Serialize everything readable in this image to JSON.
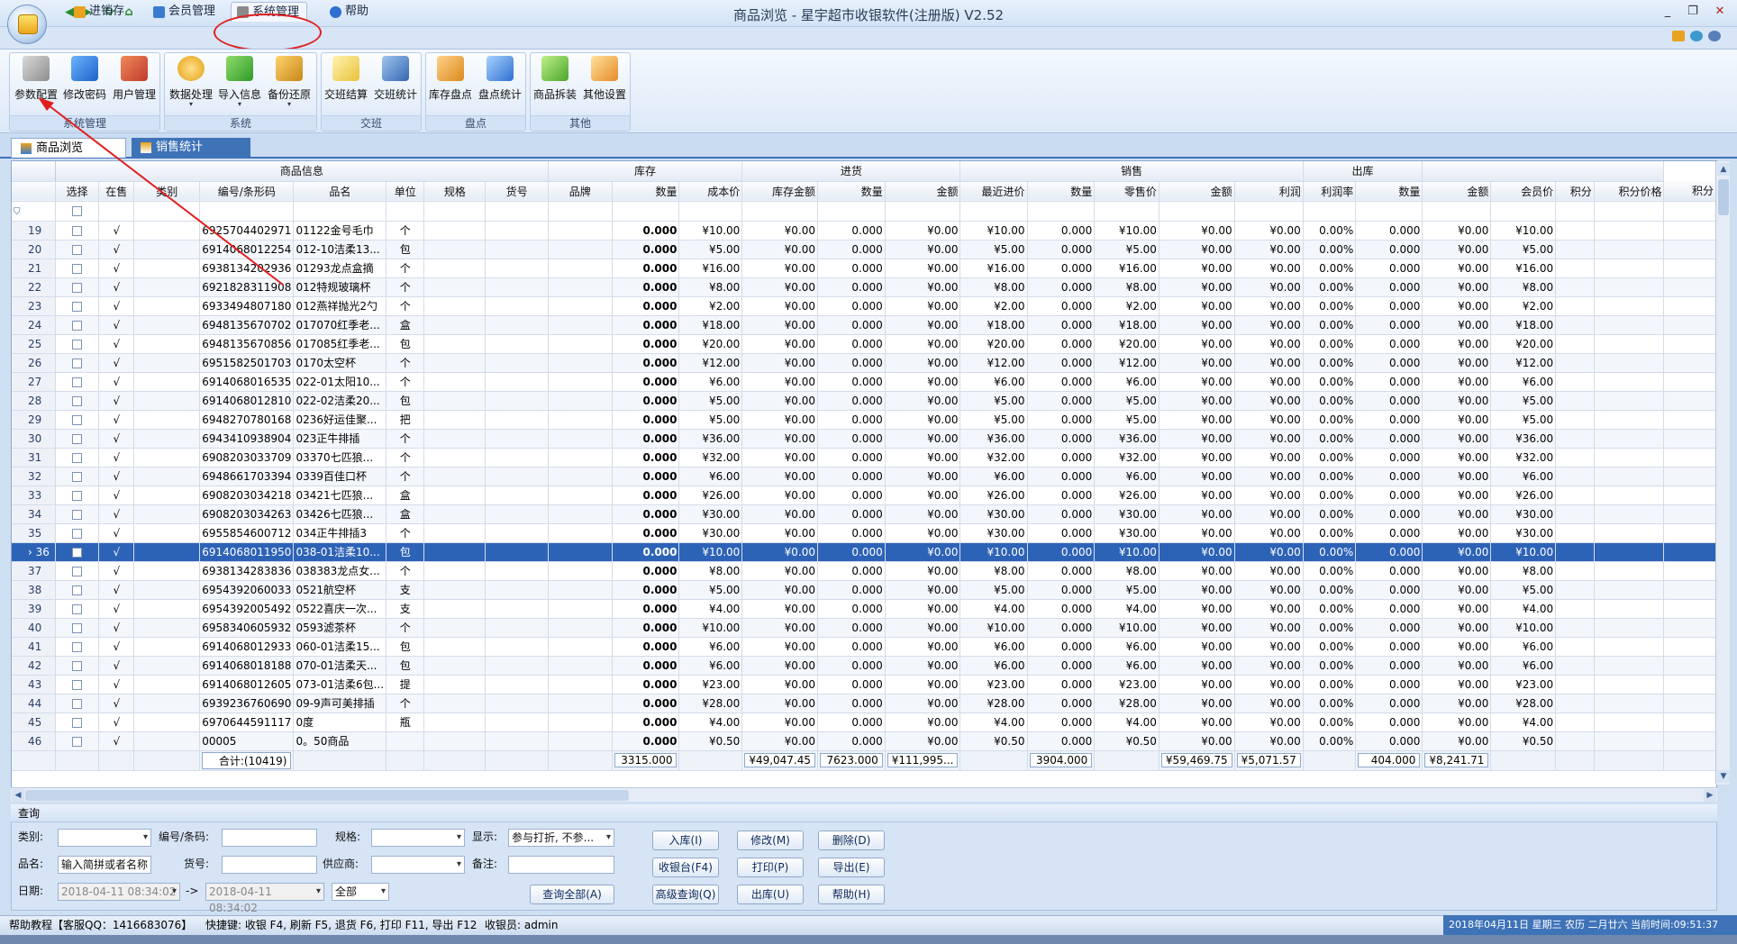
{
  "window": {
    "title": "商品浏览 - 星宇超市收银软件(注册版) V2.52"
  },
  "ribbon_tabs": [
    {
      "label": "进销存",
      "color": "#e8a21e"
    },
    {
      "label": "会员管理",
      "color": "#3a7bd0"
    },
    {
      "label": "系统管理",
      "color": "#8a8a8a"
    },
    {
      "label": "帮助",
      "color": "#2f6fd0"
    }
  ],
  "ribbon_groups": [
    {
      "label": "系统管理",
      "buttons": [
        {
          "label": "参数配置",
          "icon": "wrench-icon"
        },
        {
          "label": "修改密码",
          "icon": "key-icon"
        },
        {
          "label": "用户管理",
          "icon": "users-icon"
        }
      ]
    },
    {
      "label": "系统",
      "buttons": [
        {
          "label": "数据处理",
          "icon": "gear-icon"
        },
        {
          "label": "导入信息",
          "icon": "import-icon"
        },
        {
          "label": "备份还原",
          "icon": "backup-icon"
        }
      ]
    },
    {
      "label": "交班",
      "buttons": [
        {
          "label": "交班结算",
          "icon": "clipboard-icon"
        },
        {
          "label": "交班统计",
          "icon": "calendar-icon"
        }
      ]
    },
    {
      "label": "盘点",
      "buttons": [
        {
          "label": "库存盘点",
          "icon": "calculator-icon"
        },
        {
          "label": "盘点统计",
          "icon": "chart-icon"
        }
      ]
    },
    {
      "label": "其他",
      "buttons": [
        {
          "label": "商品拆装",
          "icon": "box-icon"
        },
        {
          "label": "其他设置",
          "icon": "settings-window-icon"
        }
      ]
    }
  ],
  "doc_tabs": [
    "商品浏览",
    "销售统计"
  ],
  "grid": {
    "header_groups": [
      "商品信息",
      "库存",
      "进货",
      "销售",
      "出库"
    ],
    "columns": [
      "选择",
      "在售",
      "类别",
      "编号/条形码",
      "品名",
      "单位",
      "规格",
      "货号",
      "品牌",
      "数量",
      "成本价",
      "库存金额",
      "数量",
      "金额",
      "最近进价",
      "数量",
      "零售价",
      "金额",
      "利润",
      "利润率",
      "数量",
      "金额",
      "会员价",
      "积分",
      "积分价格",
      "积分"
    ],
    "rows": [
      [
        "19",
        "√",
        "6925704402971",
        "01122金号毛巾",
        "个",
        "0.000",
        "¥10.00",
        "¥0.00",
        "0.000",
        "¥0.00",
        "¥10.00",
        "0.000",
        "¥10.00",
        "¥0.00",
        "¥0.00",
        "0.00%",
        "0.000",
        "¥0.00",
        "¥10.00"
      ],
      [
        "20",
        "√",
        "6914068012254",
        "012-10洁柔13...",
        "包",
        "0.000",
        "¥5.00",
        "¥0.00",
        "0.000",
        "¥0.00",
        "¥5.00",
        "0.000",
        "¥5.00",
        "¥0.00",
        "¥0.00",
        "0.00%",
        "0.000",
        "¥0.00",
        "¥5.00"
      ],
      [
        "21",
        "√",
        "6938134202936",
        "01293龙点盒摘",
        "个",
        "0.000",
        "¥16.00",
        "¥0.00",
        "0.000",
        "¥0.00",
        "¥16.00",
        "0.000",
        "¥16.00",
        "¥0.00",
        "¥0.00",
        "0.00%",
        "0.000",
        "¥0.00",
        "¥16.00"
      ],
      [
        "22",
        "√",
        "6921828311908",
        "012特规玻璃杯",
        "个",
        "0.000",
        "¥8.00",
        "¥0.00",
        "0.000",
        "¥0.00",
        "¥8.00",
        "0.000",
        "¥8.00",
        "¥0.00",
        "¥0.00",
        "0.00%",
        "0.000",
        "¥0.00",
        "¥8.00"
      ],
      [
        "23",
        "√",
        "6933494807180",
        "012燕祥抛光2勺",
        "个",
        "0.000",
        "¥2.00",
        "¥0.00",
        "0.000",
        "¥0.00",
        "¥2.00",
        "0.000",
        "¥2.00",
        "¥0.00",
        "¥0.00",
        "0.00%",
        "0.000",
        "¥0.00",
        "¥2.00"
      ],
      [
        "24",
        "√",
        "6948135670702",
        "017070红季老...",
        "盒",
        "0.000",
        "¥18.00",
        "¥0.00",
        "0.000",
        "¥0.00",
        "¥18.00",
        "0.000",
        "¥18.00",
        "¥0.00",
        "¥0.00",
        "0.00%",
        "0.000",
        "¥0.00",
        "¥18.00"
      ],
      [
        "25",
        "√",
        "6948135670856",
        "017085红季老...",
        "包",
        "0.000",
        "¥20.00",
        "¥0.00",
        "0.000",
        "¥0.00",
        "¥20.00",
        "0.000",
        "¥20.00",
        "¥0.00",
        "¥0.00",
        "0.00%",
        "0.000",
        "¥0.00",
        "¥20.00"
      ],
      [
        "26",
        "√",
        "6951582501703",
        "0170太空杯",
        "个",
        "0.000",
        "¥12.00",
        "¥0.00",
        "0.000",
        "¥0.00",
        "¥12.00",
        "0.000",
        "¥12.00",
        "¥0.00",
        "¥0.00",
        "0.00%",
        "0.000",
        "¥0.00",
        "¥12.00"
      ],
      [
        "27",
        "√",
        "6914068016535",
        "022-01太阳10...",
        "个",
        "0.000",
        "¥6.00",
        "¥0.00",
        "0.000",
        "¥0.00",
        "¥6.00",
        "0.000",
        "¥6.00",
        "¥0.00",
        "¥0.00",
        "0.00%",
        "0.000",
        "¥0.00",
        "¥6.00"
      ],
      [
        "28",
        "√",
        "6914068012810",
        "022-02洁柔20...",
        "包",
        "0.000",
        "¥5.00",
        "¥0.00",
        "0.000",
        "¥0.00",
        "¥5.00",
        "0.000",
        "¥5.00",
        "¥0.00",
        "¥0.00",
        "0.00%",
        "0.000",
        "¥0.00",
        "¥5.00"
      ],
      [
        "29",
        "√",
        "6948270780168",
        "0236好运佳聚...",
        "把",
        "0.000",
        "¥5.00",
        "¥0.00",
        "0.000",
        "¥0.00",
        "¥5.00",
        "0.000",
        "¥5.00",
        "¥0.00",
        "¥0.00",
        "0.00%",
        "0.000",
        "¥0.00",
        "¥5.00"
      ],
      [
        "30",
        "√",
        "6943410938904",
        "023正牛排插",
        "个",
        "0.000",
        "¥36.00",
        "¥0.00",
        "0.000",
        "¥0.00",
        "¥36.00",
        "0.000",
        "¥36.00",
        "¥0.00",
        "¥0.00",
        "0.00%",
        "0.000",
        "¥0.00",
        "¥36.00"
      ],
      [
        "31",
        "√",
        "6908203033709",
        "03370七匹狼...",
        "个",
        "0.000",
        "¥32.00",
        "¥0.00",
        "0.000",
        "¥0.00",
        "¥32.00",
        "0.000",
        "¥32.00",
        "¥0.00",
        "¥0.00",
        "0.00%",
        "0.000",
        "¥0.00",
        "¥32.00"
      ],
      [
        "32",
        "√",
        "6948661703394",
        "0339百佳口杯",
        "个",
        "0.000",
        "¥6.00",
        "¥0.00",
        "0.000",
        "¥0.00",
        "¥6.00",
        "0.000",
        "¥6.00",
        "¥0.00",
        "¥0.00",
        "0.00%",
        "0.000",
        "¥0.00",
        "¥6.00"
      ],
      [
        "33",
        "√",
        "6908203034218",
        "03421七匹狼...",
        "盒",
        "0.000",
        "¥26.00",
        "¥0.00",
        "0.000",
        "¥0.00",
        "¥26.00",
        "0.000",
        "¥26.00",
        "¥0.00",
        "¥0.00",
        "0.00%",
        "0.000",
        "¥0.00",
        "¥26.00"
      ],
      [
        "34",
        "√",
        "6908203034263",
        "03426七匹狼...",
        "盒",
        "0.000",
        "¥30.00",
        "¥0.00",
        "0.000",
        "¥0.00",
        "¥30.00",
        "0.000",
        "¥30.00",
        "¥0.00",
        "¥0.00",
        "0.00%",
        "0.000",
        "¥0.00",
        "¥30.00"
      ],
      [
        "35",
        "√",
        "6955854600712",
        "034正牛排插3",
        "个",
        "0.000",
        "¥30.00",
        "¥0.00",
        "0.000",
        "¥0.00",
        "¥30.00",
        "0.000",
        "¥30.00",
        "¥0.00",
        "¥0.00",
        "0.00%",
        "0.000",
        "¥0.00",
        "¥30.00"
      ],
      [
        "36",
        "√",
        "6914068011950",
        "038-01洁柔10...",
        "包",
        "0.000",
        "¥10.00",
        "¥0.00",
        "0.000",
        "¥0.00",
        "¥10.00",
        "0.000",
        "¥10.00",
        "¥0.00",
        "¥0.00",
        "0.00%",
        "0.000",
        "¥0.00",
        "¥10.00"
      ],
      [
        "37",
        "√",
        "6938134283836",
        "038383龙点女...",
        "个",
        "0.000",
        "¥8.00",
        "¥0.00",
        "0.000",
        "¥0.00",
        "¥8.00",
        "0.000",
        "¥8.00",
        "¥0.00",
        "¥0.00",
        "0.00%",
        "0.000",
        "¥0.00",
        "¥8.00"
      ],
      [
        "38",
        "√",
        "6954392060033",
        "0521航空杯",
        "支",
        "0.000",
        "¥5.00",
        "¥0.00",
        "0.000",
        "¥0.00",
        "¥5.00",
        "0.000",
        "¥5.00",
        "¥0.00",
        "¥0.00",
        "0.00%",
        "0.000",
        "¥0.00",
        "¥5.00"
      ],
      [
        "39",
        "√",
        "6954392005492",
        "0522喜庆一次...",
        "支",
        "0.000",
        "¥4.00",
        "¥0.00",
        "0.000",
        "¥0.00",
        "¥4.00",
        "0.000",
        "¥4.00",
        "¥0.00",
        "¥0.00",
        "0.00%",
        "0.000",
        "¥0.00",
        "¥4.00"
      ],
      [
        "40",
        "√",
        "6958340605932",
        "0593滤茶杯",
        "个",
        "0.000",
        "¥10.00",
        "¥0.00",
        "0.000",
        "¥0.00",
        "¥10.00",
        "0.000",
        "¥10.00",
        "¥0.00",
        "¥0.00",
        "0.00%",
        "0.000",
        "¥0.00",
        "¥10.00"
      ],
      [
        "41",
        "√",
        "6914068012933",
        "060-01洁柔15...",
        "包",
        "0.000",
        "¥6.00",
        "¥0.00",
        "0.000",
        "¥0.00",
        "¥6.00",
        "0.000",
        "¥6.00",
        "¥0.00",
        "¥0.00",
        "0.00%",
        "0.000",
        "¥0.00",
        "¥6.00"
      ],
      [
        "42",
        "√",
        "6914068018188",
        "070-01洁柔天...",
        "包",
        "0.000",
        "¥6.00",
        "¥0.00",
        "0.000",
        "¥0.00",
        "¥6.00",
        "0.000",
        "¥6.00",
        "¥0.00",
        "¥0.00",
        "0.00%",
        "0.000",
        "¥0.00",
        "¥6.00"
      ],
      [
        "43",
        "√",
        "6914068012605",
        "073-01洁柔6包...",
        "提",
        "0.000",
        "¥23.00",
        "¥0.00",
        "0.000",
        "¥0.00",
        "¥23.00",
        "0.000",
        "¥23.00",
        "¥0.00",
        "¥0.00",
        "0.00%",
        "0.000",
        "¥0.00",
        "¥23.00"
      ],
      [
        "44",
        "√",
        "6939236760690",
        "09-9声可美排插",
        "个",
        "0.000",
        "¥28.00",
        "¥0.00",
        "0.000",
        "¥0.00",
        "¥28.00",
        "0.000",
        "¥28.00",
        "¥0.00",
        "¥0.00",
        "0.00%",
        "0.000",
        "¥0.00",
        "¥28.00"
      ],
      [
        "45",
        "√",
        "6970644591117",
        "0度",
        "瓶",
        "0.000",
        "¥4.00",
        "¥0.00",
        "0.000",
        "¥0.00",
        "¥4.00",
        "0.000",
        "¥4.00",
        "¥0.00",
        "¥0.00",
        "0.00%",
        "0.000",
        "¥0.00",
        "¥4.00"
      ],
      [
        "46",
        "√",
        "00005",
        "0。50商品",
        "",
        "0.000",
        "¥0.50",
        "¥0.00",
        "0.000",
        "¥0.00",
        "¥0.50",
        "0.000",
        "¥0.50",
        "¥0.00",
        "¥0.00",
        "0.00%",
        "0.000",
        "¥0.00",
        "¥0.50"
      ]
    ],
    "selected_row": "36",
    "totals": {
      "label": "合计:(10419)",
      "stock_qty": "3315.000",
      "stock_amount": "¥49,047.45",
      "purchase_qty": "7623.000",
      "purchase_amount": "¥111,995...",
      "sales_qty": "3904.000",
      "sales_amount": "¥59,469.75",
      "profit": "¥5,071.57",
      "out_qty": "404.000",
      "out_amount": "¥8,241.71"
    }
  },
  "query": {
    "title": "查询",
    "labels": {
      "category": "类别:",
      "code": "编号/条码:",
      "spec": "规格:",
      "display": "显示:",
      "name": "品名:",
      "item_no": "货号:",
      "supplier": "供应商:",
      "remark": "备注:",
      "date": "日期:",
      "date_sep": "->"
    },
    "display_value": "参与打折, 不参...",
    "name_placeholder": "输入简拼或者名称",
    "date_from": "2018-04-11 08:34:02",
    "date_to": "2018-04-11 08:34:02",
    "date_range": "全部",
    "buttons": {
      "query_all": "查询全部(A)",
      "stock_in": "入库(I)",
      "modify": "修改(M)",
      "delete": "删除(D)",
      "pos": "收银台(F4)",
      "print": "打印(P)",
      "export": "导出(E)",
      "advanced": "高级查询(Q)",
      "stock_out": "出库(U)",
      "help": "帮助(H)"
    }
  },
  "status": {
    "help": "帮助教程【客服QQ：1416683076】",
    "shortcuts": "快捷键: 收银 F4, 刷新 F5, 退货 F6, 打印 F11, 导出 F12",
    "cashier": "收银员: admin",
    "datetime": "2018年04月11日 星期三 农历 二月廿六 当前时间:09:51:37"
  },
  "colors": {
    "selection": "#2d63b7",
    "annotation": "#e02020",
    "frame": "#cfdff2"
  }
}
